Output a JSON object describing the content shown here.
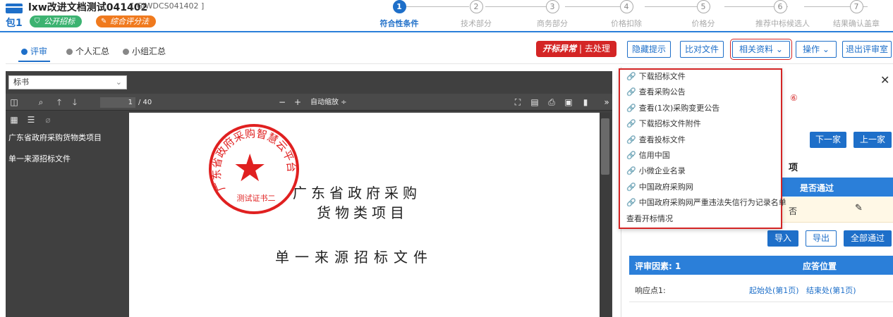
{
  "header": {
    "title": "lxw改进文档测试041402",
    "code": "[ GJWDCS041402 ]",
    "package": "包1",
    "tag_open": "公开招标",
    "tag_method": "综合评分法"
  },
  "steps": [
    {
      "num": "1",
      "label": "符合性条件",
      "active": true
    },
    {
      "num": "2",
      "label": "技术部分"
    },
    {
      "num": "3",
      "label": "商务部分"
    },
    {
      "num": "4",
      "label": "价格扣除"
    },
    {
      "num": "5",
      "label": "价格分"
    },
    {
      "num": "6",
      "label": "推荐中标候选人"
    },
    {
      "num": "7",
      "label": "结果确认盖章"
    }
  ],
  "tabs": [
    "评审",
    "个人汇总",
    "小组汇总"
  ],
  "toolbar": {
    "anomaly_strong": "开标异常",
    "anomaly_action": "| 去处理",
    "hide_hint": "隐藏提示",
    "compare": "比对文件",
    "related": "相关资料",
    "operate": "操作",
    "exit": "退出评审室"
  },
  "viewer": {
    "doc_select": "标书",
    "page_current": "1",
    "page_total": "/ 40",
    "zoom": "自动缩放 ÷",
    "outline": [
      "广东省政府采购货物类项目",
      "单一来源招标文件"
    ],
    "doc_line1": "广东省政府采购",
    "doc_line2": "货物类项目",
    "doc_line3": "单一来源招标文件",
    "seal_arc": "广东省政府采购智慧云平台",
    "seal_sub": "测试证书二"
  },
  "dropdown": [
    "下载招标文件",
    "查看采购公告",
    "查看(1次)采购变更公告",
    "下载招标文件附件",
    "查看投标文件",
    "信用中国",
    "小微企业名录",
    "中国政府采购网",
    "中国政府采购网严重违法失信行为记录名单",
    "查看开标情况"
  ],
  "right": {
    "marker": "⑥",
    "next": "下一家",
    "prev": "上一家",
    "section_title": "项",
    "col_pass": "是否通过",
    "row_value": "否",
    "import": "导入",
    "export": "导出",
    "pass_all": "全部通过",
    "factor": "评审因素: 1",
    "answer_pos": "应答位置",
    "point": "响应点1:",
    "start": "起始处(第1页)",
    "end": "结束处(第1页)"
  }
}
